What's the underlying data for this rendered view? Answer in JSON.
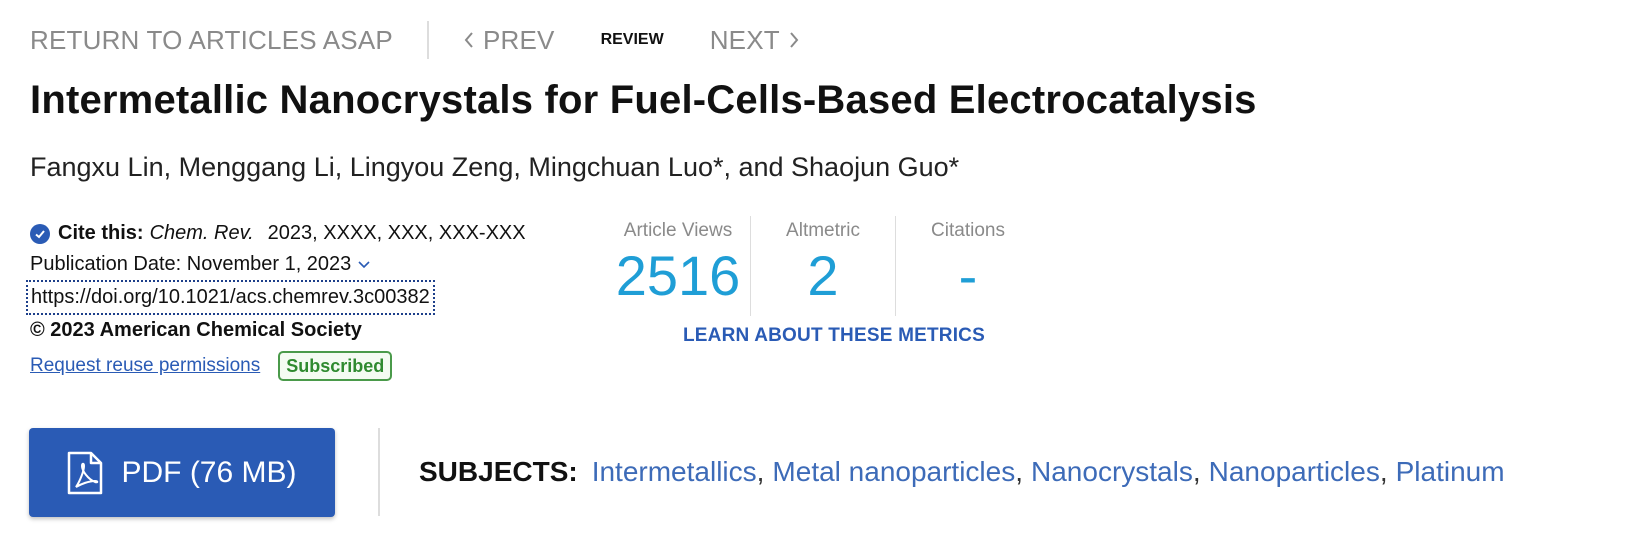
{
  "nav": {
    "return_label": "RETURN TO ARTICLES ASAP",
    "prev_label": "PREV",
    "current_label": "REVIEW",
    "next_label": "NEXT"
  },
  "article": {
    "title": "Intermetallic Nanocrystals for Fuel-Cells-Based Electrocatalysis",
    "authors": "Fangxu Lin, Menggang Li, Lingyou Zeng, Mingchuan Luo*, and Shaojun Guo*"
  },
  "cite": {
    "label": "Cite this:",
    "journal": "Chem. Rev.",
    "ref": "2023, XXXX, XXX, XXX-XXX",
    "pub_date": "Publication Date: November 1, 2023",
    "doi": "https://doi.org/10.1021/acs.chemrev.3c00382",
    "copyright": "© 2023 American Chemical Society",
    "reuse_label": "Request reuse permissions",
    "badge": "Subscribed"
  },
  "metrics": {
    "items": [
      {
        "label": "Article Views",
        "value": "2516"
      },
      {
        "label": "Altmetric",
        "value": "2"
      },
      {
        "label": "Citations",
        "value": "-"
      }
    ],
    "learn_label": "LEARN ABOUT THESE METRICS"
  },
  "pdf": {
    "label": "PDF (76 MB)"
  },
  "subjects": {
    "label": "SUBJECTS:",
    "items": [
      "Intermetallics",
      "Metal nanoparticles",
      "Nanocrystals",
      "Nanoparticles",
      "Platinum"
    ]
  },
  "colors": {
    "accent": "#2a5bb5",
    "metric_value": "#1f9ed6",
    "badge_green": "#2f8a2f"
  },
  "icons": {
    "prev": "chevron-left-icon",
    "next": "chevron-right-icon",
    "check": "check-circle-icon",
    "date_toggle": "chevron-down-icon",
    "pdf": "pdf-file-icon"
  }
}
